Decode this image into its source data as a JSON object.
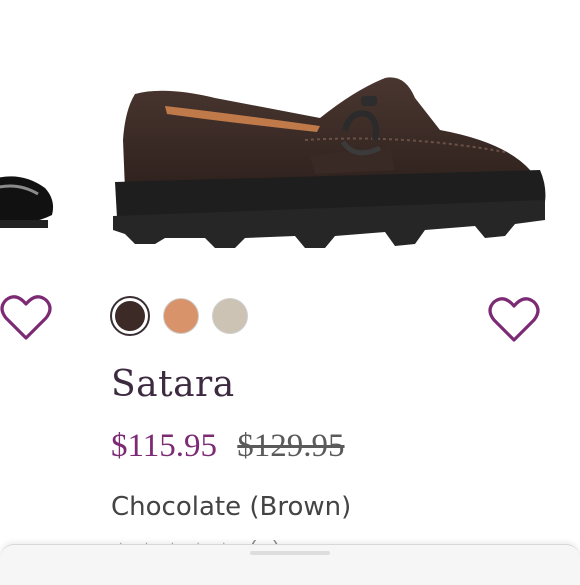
{
  "product": {
    "name": "Satara",
    "sale_price": "$115.95",
    "original_price": "$129.95",
    "color_name": "Chocolate (Brown)",
    "rating_stars": 5,
    "rating_count_text": "(...)"
  },
  "swatches": [
    {
      "label": "Chocolate",
      "color": "#3b2a26",
      "selected": true
    },
    {
      "label": "Tan",
      "color": "#d8936a",
      "selected": false
    },
    {
      "label": "Stone",
      "color": "#cdc3b4",
      "selected": false
    }
  ],
  "colors": {
    "accent": "#7b2a73",
    "title": "#3d2a40",
    "heart": "#7b2a73"
  },
  "icons": {
    "favorite_left": "heart-outline-icon",
    "favorite_right": "heart-outline-icon",
    "star": "star-icon"
  }
}
